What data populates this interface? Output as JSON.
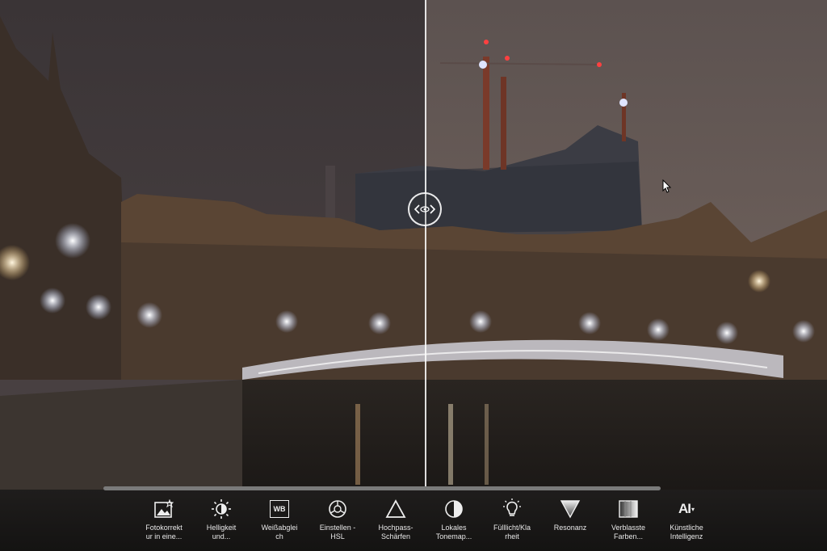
{
  "toolbar": {
    "tools": [
      {
        "label": "Fotokorrekt\nur in eine...",
        "icon": "photo-magic-icon"
      },
      {
        "label": "Helligkeit\nund...",
        "icon": "brightness-icon"
      },
      {
        "label": "Weißabglei\nch",
        "icon": "wb-icon",
        "icon_text": "WB"
      },
      {
        "label": "Einstellen -\nHSL",
        "icon": "hsl-wheel-icon"
      },
      {
        "label": "Hochpass-\nSchärfen",
        "icon": "triangle-icon"
      },
      {
        "label": "Lokales\nTonemap...",
        "icon": "half-circle-icon"
      },
      {
        "label": "Fülllicht/Kla\nrheit",
        "icon": "bulb-icon"
      },
      {
        "label": "Resonanz",
        "icon": "inverted-triangle-icon"
      },
      {
        "label": "Verblasste\nFarben...",
        "icon": "faded-colors-icon"
      },
      {
        "label": "Künstliche\nIntelligenz",
        "icon": "ai-icon",
        "icon_text": "AI"
      }
    ]
  },
  "colors": {
    "toolbar_bg": "#1a1817",
    "label": "#e8e8e8",
    "split_line": "#ffffff"
  }
}
